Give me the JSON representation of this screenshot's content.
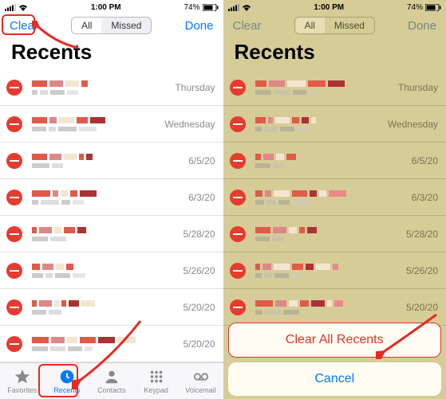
{
  "status": {
    "time": "1:00 PM",
    "battery_pct": "74%"
  },
  "nav": {
    "clear": "Clear",
    "done": "Done",
    "seg_all": "All",
    "seg_missed": "Missed"
  },
  "title": "Recents",
  "rows": [
    {
      "date": "Thursday"
    },
    {
      "date": "Wednesday"
    },
    {
      "date": "6/5/20"
    },
    {
      "date": "6/3/20"
    },
    {
      "date": "5/28/20"
    },
    {
      "date": "5/26/20"
    },
    {
      "date": "5/20/20"
    },
    {
      "date": "5/20/20"
    }
  ],
  "tabs": {
    "favorites": "Favorites",
    "recents": "Recents",
    "contacts": "Contacts",
    "keypad": "Keypad",
    "voicemail": "Voicemail"
  },
  "sheet": {
    "clear_all": "Clear All Recents",
    "cancel": "Cancel"
  }
}
